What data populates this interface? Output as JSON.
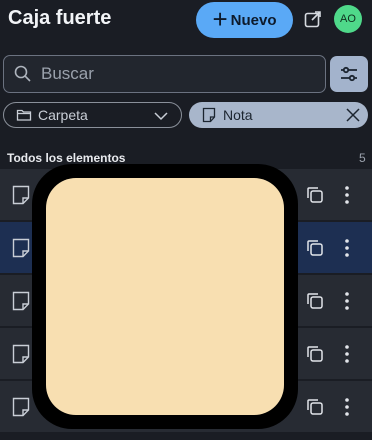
{
  "header": {
    "title": "Caja fuerte",
    "new_label": "Nuevo",
    "avatar_initials": "AO",
    "accent_color": "#5aa9f6",
    "avatar_color": "#4fd98a"
  },
  "search": {
    "placeholder": "Buscar",
    "value": ""
  },
  "filters": {
    "folder_label": "Carpeta",
    "type_label": "Nota"
  },
  "list": {
    "section_title": "Todos los elementos",
    "count": "5",
    "items": [
      {
        "type_icon": "note-icon",
        "selected": false
      },
      {
        "type_icon": "note-icon",
        "selected": true
      },
      {
        "type_icon": "note-icon",
        "selected": false
      },
      {
        "type_icon": "note-icon",
        "selected": false
      },
      {
        "type_icon": "note-icon",
        "selected": false
      }
    ]
  },
  "overlay": {
    "fill_color": "#f8dfb1",
    "border_color": "#000000"
  }
}
